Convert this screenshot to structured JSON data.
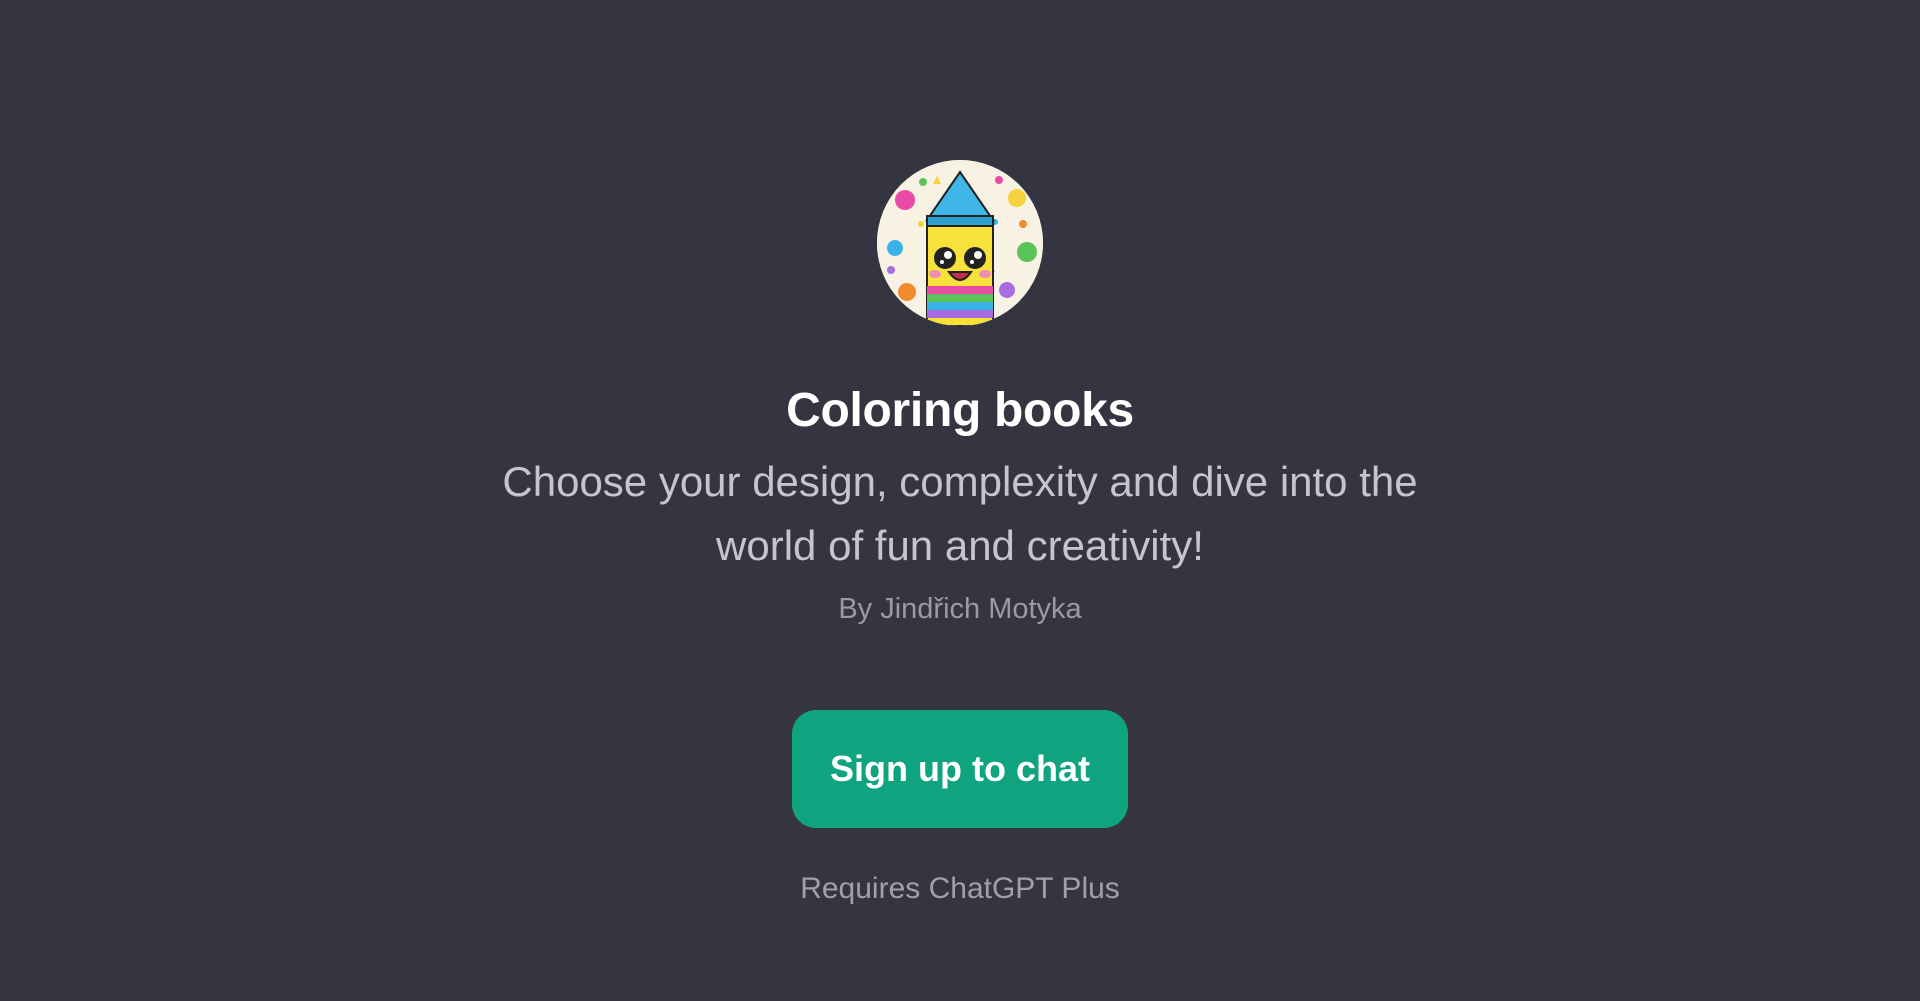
{
  "gpt": {
    "avatar_icon": "crayon-character-icon",
    "title": "Coloring books",
    "description": "Choose your design, complexity and dive into the world of fun and creativity!",
    "author": "By Jindřich Motyka"
  },
  "actions": {
    "signup_label": "Sign up to chat",
    "requirement": "Requires ChatGPT Plus"
  },
  "colors": {
    "background": "#343541",
    "button": "#10a37f",
    "title": "#ffffff",
    "description": "#c5c5d2",
    "muted": "#9a9aa6"
  }
}
